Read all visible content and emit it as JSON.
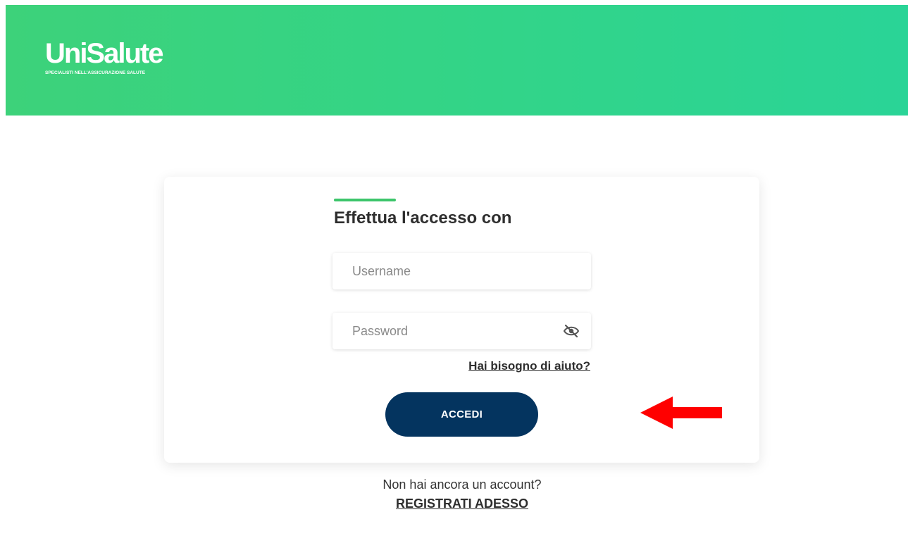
{
  "header": {
    "logo_name": "UniSalute",
    "logo_tagline": "SPECIALISTI NELL'ASSICURAZIONE SALUTE",
    "background_color": "#35d38a"
  },
  "login": {
    "title": "Effettua l'accesso con",
    "accent_color": "#3dc56b",
    "username_placeholder": "Username",
    "username_value": "",
    "password_placeholder": "Password",
    "password_value": "",
    "password_toggle_icon": "eye-slash-icon",
    "help_link": "Hai bisogno di aiuto?",
    "submit_label": "ACCEDI",
    "button_color": "#04345f"
  },
  "annotation": {
    "arrow_icon": "left-arrow-icon",
    "arrow_color": "#ff0000"
  },
  "footer": {
    "no_account_text": "Non hai ancora un account?",
    "register_link": "REGISTRATI ADESSO"
  }
}
